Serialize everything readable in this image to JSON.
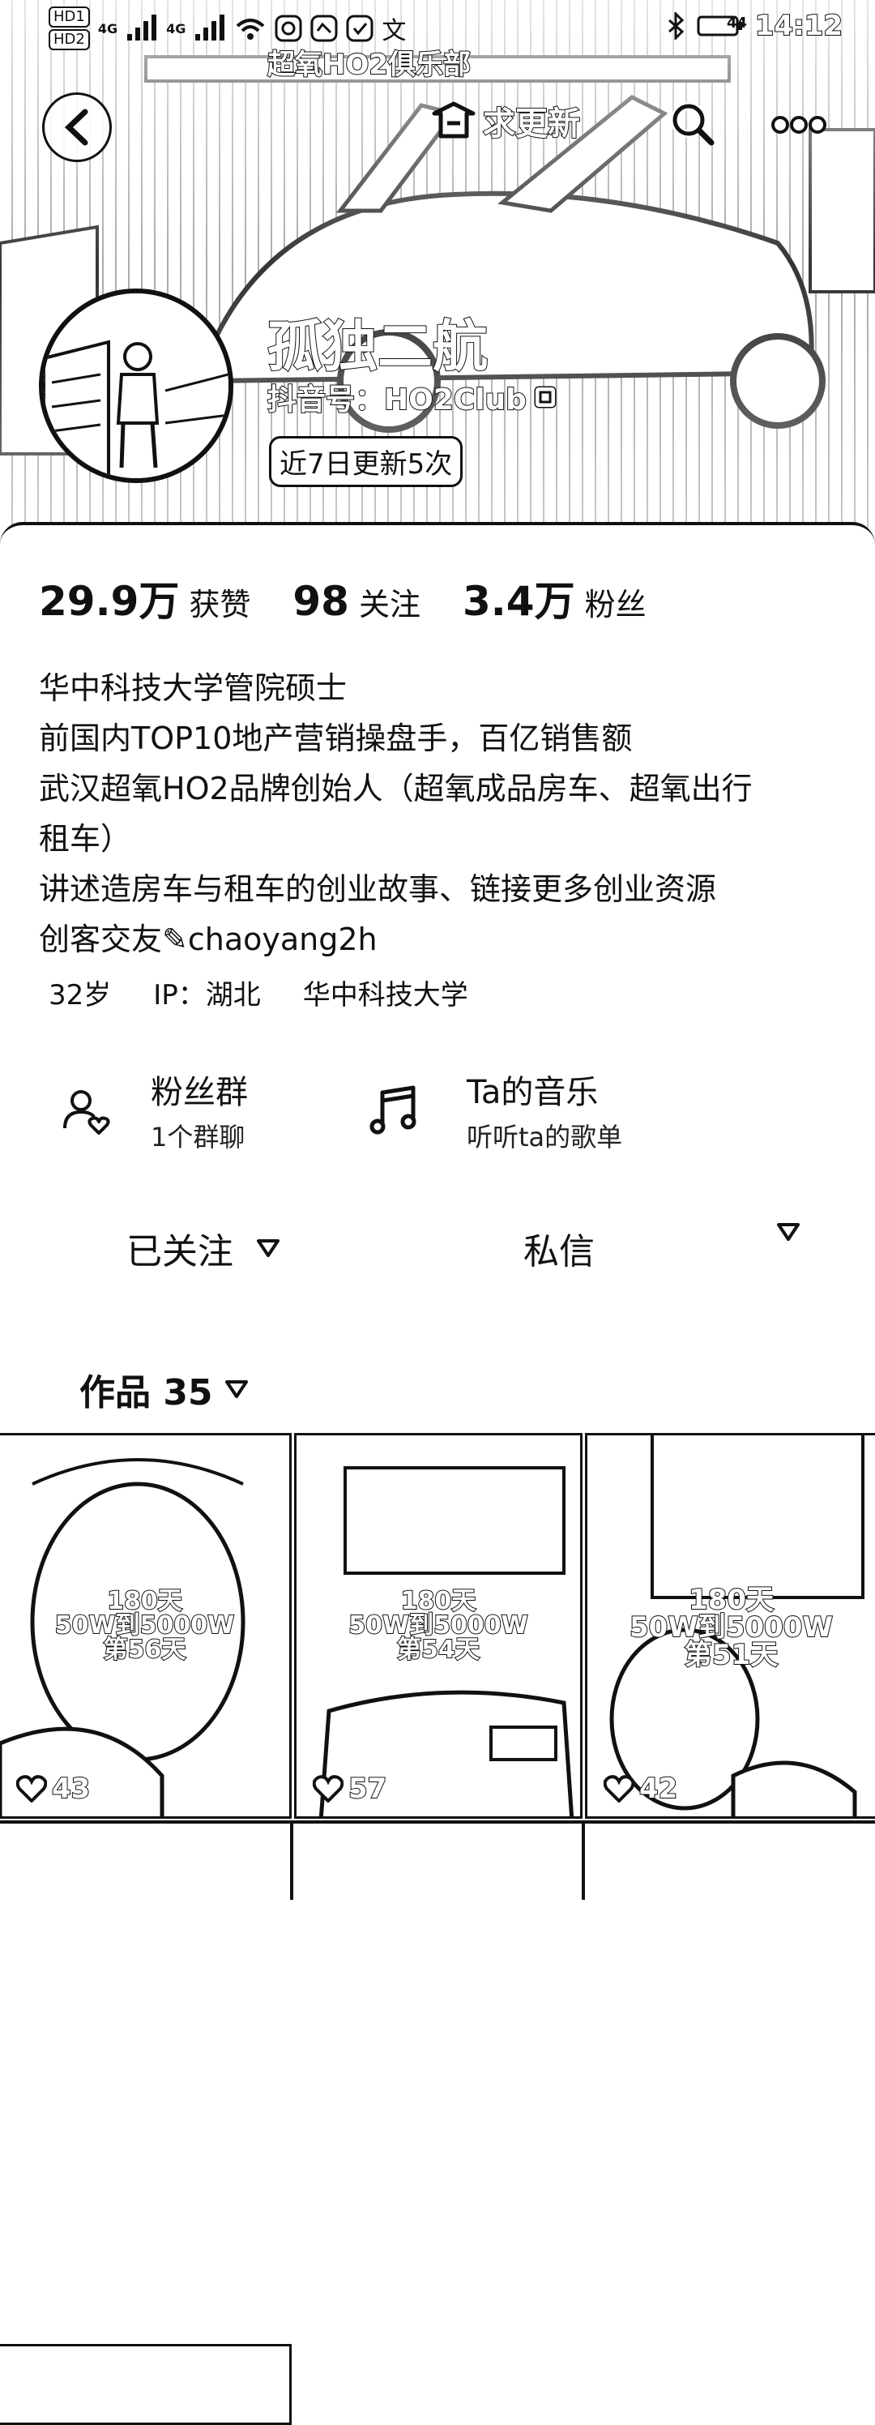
{
  "status_bar": {
    "sim1": "HD1",
    "sim2": "HD2",
    "net1": "4G",
    "net2": "4G",
    "battery": "44",
    "time": "14:12"
  },
  "header": {
    "sign_text": "超氧HO2俱乐部",
    "request_update_label": "求更新"
  },
  "profile": {
    "name": "孤独二航",
    "douyin_id": "抖音号：HO2Club",
    "update_badge": "近7日更新5次"
  },
  "stats": [
    {
      "value": "29.9万",
      "label": "获赞"
    },
    {
      "value": "98",
      "label": "关注"
    },
    {
      "value": "3.4万",
      "label": "粉丝"
    }
  ],
  "bio": {
    "lines": [
      "华中科技大学管院硕士",
      "前国内TOP10地产营销操盘手，百亿销售额",
      "武汉超氧HO2品牌创始人（超氧成品房车、超氧出行",
      "租车）",
      "讲述造房车与租车的创业故事、链接更多创业资源",
      "创客交友✎chaoyang2h"
    ]
  },
  "meta": {
    "age": "32岁",
    "ip": "IP：湖北",
    "school": "华中科技大学"
  },
  "features": [
    {
      "title": "粉丝群",
      "subtitle": "1个群聊",
      "icon": "fan-group-icon"
    },
    {
      "title": "Ta的音乐",
      "subtitle": "听听ta的歌单",
      "icon": "music-note-icon"
    }
  ],
  "actions": {
    "follow_label": "已关注",
    "message_label": "私信"
  },
  "works": {
    "label": "作品 35",
    "items": [
      {
        "line1": "180天",
        "line2": "50W到5000W",
        "line3": "第56天",
        "likes": "43"
      },
      {
        "line1": "180天",
        "line2": "50W到5000W",
        "line3": "第54天",
        "likes": "57"
      },
      {
        "line1": "180天",
        "line2": "50W到5000W",
        "line3": "第51天",
        "likes": "42"
      }
    ]
  }
}
